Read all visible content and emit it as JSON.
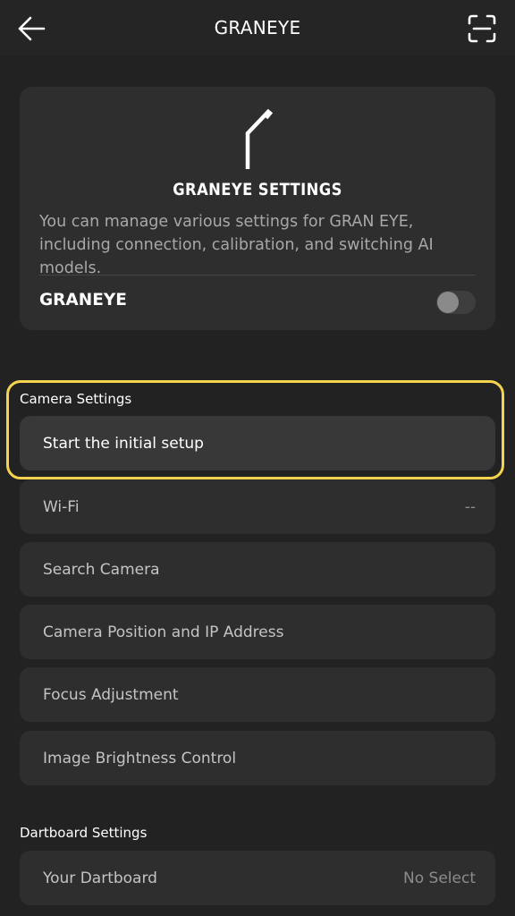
{
  "header": {
    "title": "GRANEYE",
    "back_icon": "arrow-left-icon",
    "scan_icon": "scan-icon"
  },
  "info_card": {
    "icon": "camera-arm-icon",
    "title": "GRANEYE SETTINGS",
    "description": "You can manage various settings for GRAN EYE, including connection, calibration, and switching AI models.",
    "toggle_label": "GRANEYE",
    "toggle_on": false
  },
  "camera_settings": {
    "heading": "Camera Settings",
    "initial_setup": "Start the initial setup",
    "items": [
      {
        "label": "Wi-Fi",
        "value": "--"
      },
      {
        "label": "Search Camera",
        "value": ""
      },
      {
        "label": "Camera Position and IP Address",
        "value": ""
      },
      {
        "label": "Focus Adjustment",
        "value": ""
      },
      {
        "label": "Image Brightness Control",
        "value": ""
      }
    ]
  },
  "dartboard_settings": {
    "heading": "Dartboard Settings",
    "items": [
      {
        "label": "Your Dartboard",
        "value": "No Select"
      }
    ]
  },
  "colors": {
    "background": "#222222",
    "card": "#2e2e2e",
    "highlight": "#f5d34e"
  }
}
